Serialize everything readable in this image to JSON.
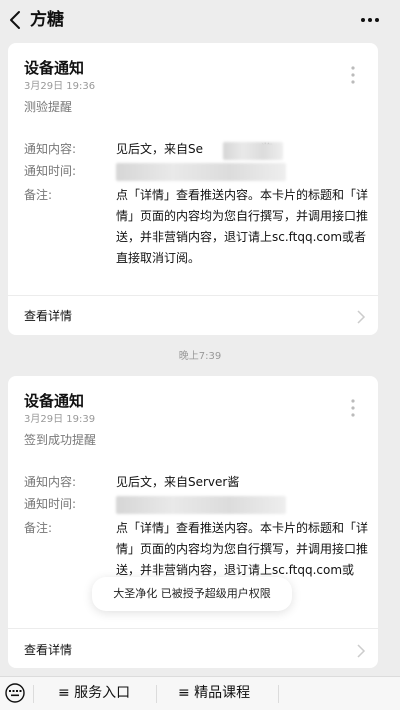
{
  "header": {
    "title": "方糖"
  },
  "cards": [
    {
      "title": "设备通知",
      "date": "3月29日 19:36",
      "subtitle": "测验提醒",
      "content_label": "通知内容:",
      "content_value": "见后文，来自Se",
      "content_tail": "酱",
      "time_label": "通知时间:",
      "note_label": "备注:",
      "note_value": "点「详情」查看推送内容。本卡片的标题和「详情」页面的内容均为您自行撰写，并调用接口推送，并非营销内容，退订请上sc.ftqq.com或者直接取消订阅。",
      "detail_label": "查看详情"
    },
    {
      "title": "设备通知",
      "date": "3月29日 19:39",
      "subtitle": "签到成功提醒",
      "content_label": "通知内容:",
      "content_value": "见后文，来自Server酱",
      "time_label": "通知时间:",
      "note_label": "备注:",
      "note_value": "点「详情」查看推送内容。本卡片的标题和「详情」页面的内容均为您自行撰写，并调用接口推送，并非营销内容，退订请上sc.ftqq.com或",
      "detail_label": "查看详情"
    }
  ],
  "time_separator": "晚上7:39",
  "toast": "大圣净化 已被授予超级用户权限",
  "bottom_menu": [
    {
      "label": "≡ 服务入口"
    },
    {
      "label": "≡ 精品课程"
    }
  ],
  "icons": {
    "back": "chevron-left-icon",
    "more": "more-dots-icon",
    "kebab": "vertical-dots-icon",
    "chevron": "chevron-right-icon",
    "keyboard": "keyboard-icon"
  }
}
